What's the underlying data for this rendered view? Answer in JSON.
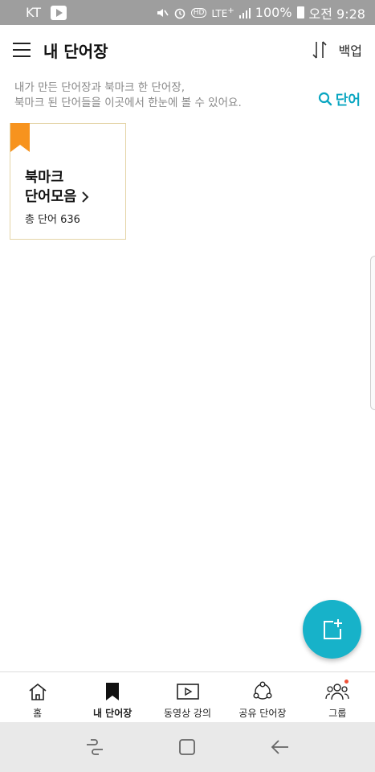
{
  "status_bar": {
    "carrier": "KT",
    "network": "LTE",
    "network_superscript": "+",
    "hd_label": "HD",
    "battery": "100%",
    "time": "오전 9:28"
  },
  "header": {
    "title": "내 단어장",
    "backup_label": "백업"
  },
  "info": {
    "line1": "내가 만든 단어장과 북마크 한 단어장,",
    "line2": "북마크 된 단어들을 이곳에서 한눈에 볼 수 있어요.",
    "search_label": "단어"
  },
  "card": {
    "title_line1": "북마크",
    "title_line2": "단어모음",
    "count_label": "총 단어 636"
  },
  "bottom_nav": {
    "items": [
      {
        "label": "홈",
        "icon": "home-icon"
      },
      {
        "label": "내 단어장",
        "icon": "bookmark-icon"
      },
      {
        "label": "동영상 강의",
        "icon": "video-icon"
      },
      {
        "label": "공유 단어장",
        "icon": "share-icon"
      },
      {
        "label": "그룹",
        "icon": "group-icon"
      }
    ],
    "active_index": 1
  },
  "colors": {
    "accent": "#17b2c9",
    "bookmark": "#f7931e",
    "badge": "#f0533a"
  }
}
